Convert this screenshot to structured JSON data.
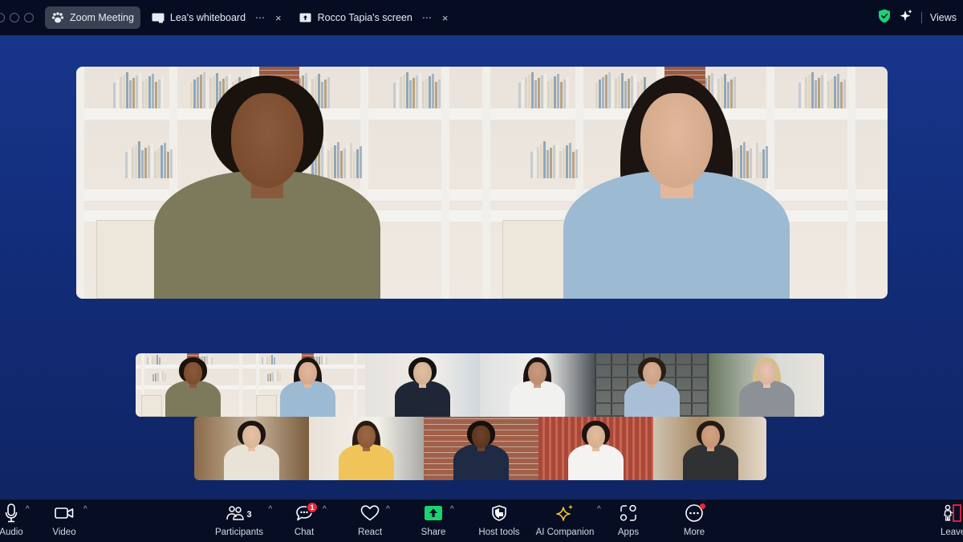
{
  "window": {
    "tabs": [
      {
        "label": "Zoom Meeting",
        "icon": "zoom-paw-icon",
        "active": true
      },
      {
        "label": "Lea's whiteboard",
        "icon": "whiteboard-icon",
        "active": false,
        "more": "⋯",
        "close": "×"
      },
      {
        "label": "Rocco Tapia's screen",
        "icon": "share-screen-icon",
        "active": false,
        "more": "⋯",
        "close": "×"
      }
    ],
    "right": {
      "security_icon": "shield-check-icon",
      "ai_icon": "sparkle-icon",
      "views_label": "Views"
    }
  },
  "speakers": [
    {
      "name": "speaker-1",
      "description": "woman with curly hair, olive t-shirt, white bookshelf background",
      "skin": "#8a5a3c",
      "hair": "#1a120d",
      "shirt": "#7d7a5c"
    },
    {
      "name": "speaker-2",
      "description": "woman with long dark hair, light denim shirt, waving, bookshelf and brick background",
      "skin": "#e2b79a",
      "hair": "#1b1410",
      "shirt": "#9dbad3"
    }
  ],
  "gallery": {
    "row1": [
      {
        "name": "participant-1",
        "skin": "#8a5a3c",
        "hair": "#1a120d",
        "shirt": "#7d7a5c",
        "bg": "shelf"
      },
      {
        "name": "participant-2",
        "skin": "#e2b79a",
        "hair": "#1b1410",
        "shirt": "#9dbad3",
        "bg": "shelf"
      },
      {
        "name": "participant-3",
        "skin": "#e1bfa2",
        "hair": "#15110f",
        "shirt": "#1f2636",
        "bg": "window"
      },
      {
        "name": "participant-4",
        "skin": "#c99a7d",
        "hair": "#1b1512",
        "shirt": "#f1f1ef",
        "bg": "office"
      },
      {
        "name": "participant-5",
        "skin": "#d9ae93",
        "hair": "#2a1e17",
        "shirt": "#a9bfd8",
        "bg": "darkshelf"
      },
      {
        "name": "participant-6",
        "skin": "#e8c4ae",
        "hair": "#d7bd8a",
        "shirt": "#8b9196",
        "bg": "room"
      }
    ],
    "row2": [
      {
        "name": "participant-7",
        "skin": "#e7c3a6",
        "hair": "#1c1511",
        "shirt": "#e9e2d6",
        "bg": "cafe"
      },
      {
        "name": "participant-8",
        "skin": "#9a6847",
        "hair": "#2a1b12",
        "shirt": "#f1c45a",
        "bg": "bright"
      },
      {
        "name": "participant-9",
        "skin": "#6b432c",
        "hair": "#16100c",
        "shirt": "#1f2a44",
        "bg": "brick"
      },
      {
        "name": "participant-10",
        "skin": "#e2bc9d",
        "hair": "#1c1410",
        "shirt": "#f4f3f1",
        "bg": "red"
      },
      {
        "name": "participant-11",
        "skin": "#d3a383",
        "hair": "#231a14",
        "shirt": "#2f3133",
        "bg": "blur"
      }
    ]
  },
  "toolbar": {
    "audio": {
      "label": "Audio",
      "icon": "microphone-icon"
    },
    "video": {
      "label": "Video",
      "icon": "video-camera-icon"
    },
    "participants": {
      "label": "Participants",
      "icon": "participants-icon",
      "count": "3"
    },
    "chat": {
      "label": "Chat",
      "icon": "chat-icon",
      "badge": "1"
    },
    "react": {
      "label": "React",
      "icon": "heart-icon"
    },
    "share": {
      "label": "Share",
      "icon": "share-arrow-icon",
      "accent": "#19d46e"
    },
    "host_tools": {
      "label": "Host tools",
      "icon": "host-shield-icon"
    },
    "ai_companion": {
      "label": "AI Companion",
      "icon": "ai-sparkle-icon",
      "accent": "#f5c730"
    },
    "apps": {
      "label": "Apps",
      "icon": "apps-icon"
    },
    "more": {
      "label": "More",
      "icon": "more-dots-icon"
    },
    "leave": {
      "label": "Leave",
      "icon": "leave-icon",
      "accent": "#e8283e"
    }
  },
  "caret": "^"
}
